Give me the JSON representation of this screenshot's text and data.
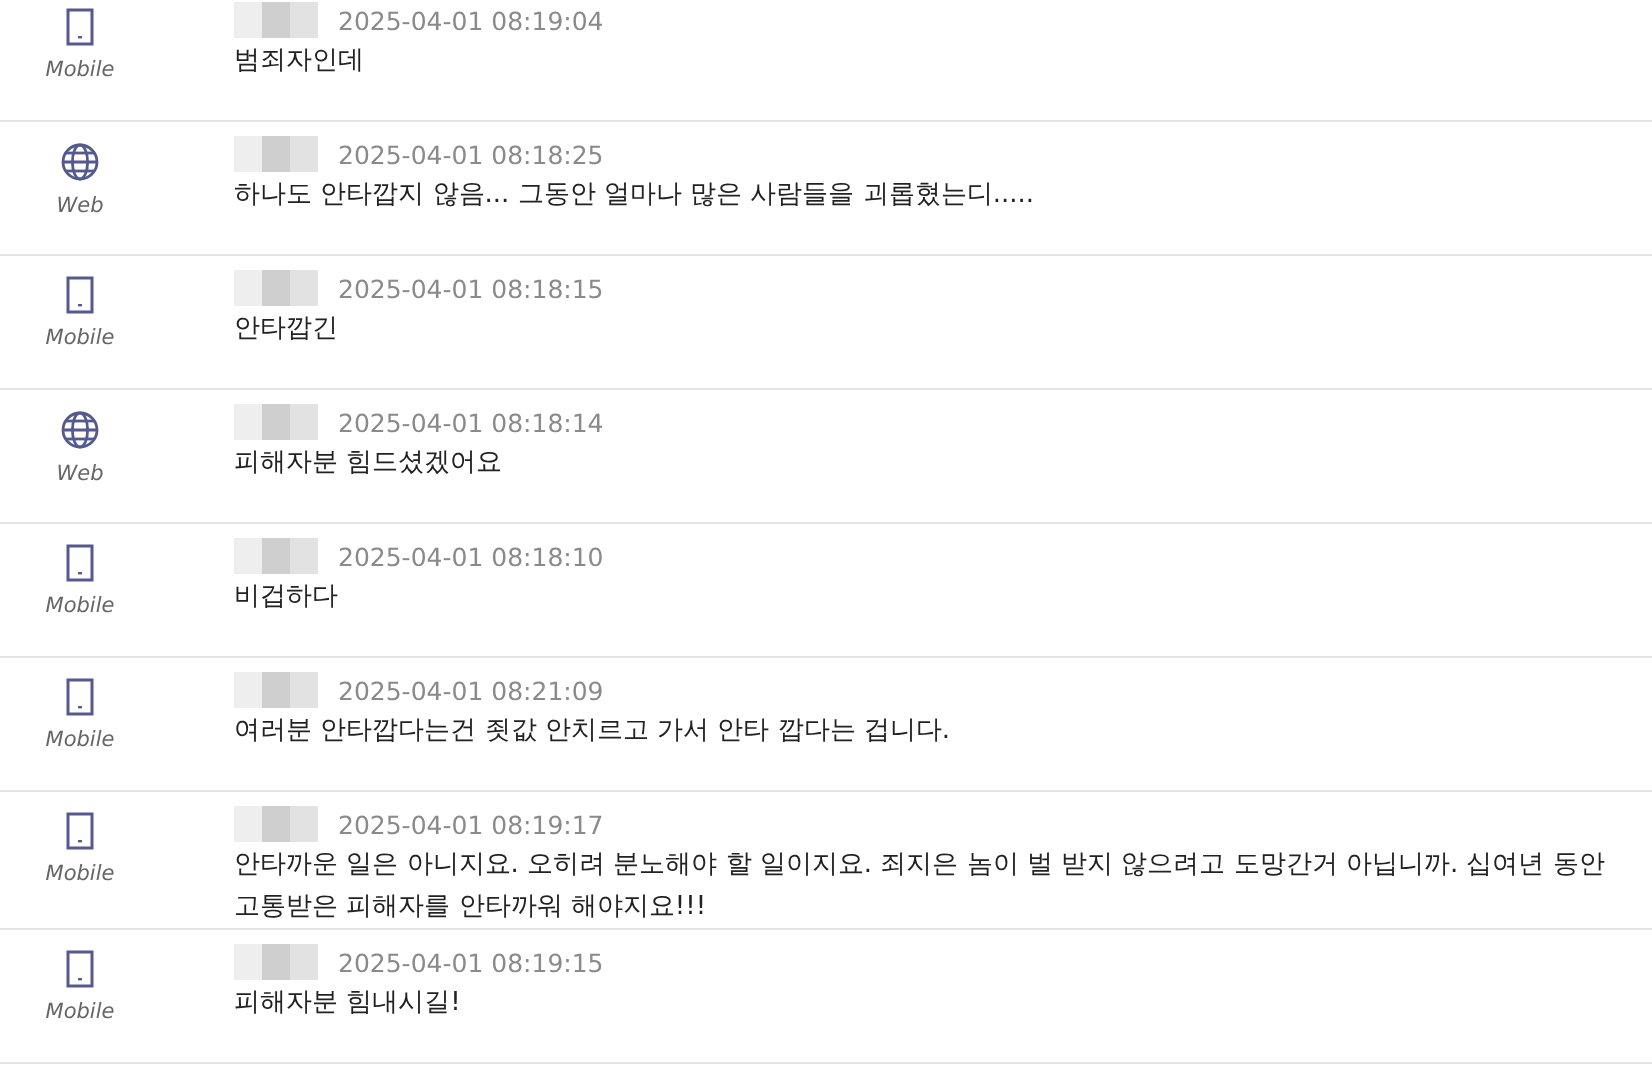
{
  "comments": [
    {
      "device": {
        "kind": "mobile",
        "label": "Mobile"
      },
      "time": "2025-04-01 08:19:04",
      "text": "범죄자인데"
    },
    {
      "device": {
        "kind": "web",
        "label": "Web"
      },
      "time": "2025-04-01 08:18:25",
      "text": "하나도 안타깝지 않음... 그동안 얼마나 많은 사람들을 괴롭혔는디....."
    },
    {
      "device": {
        "kind": "mobile",
        "label": "Mobile"
      },
      "time": "2025-04-01 08:18:15",
      "text": "안타깝긴"
    },
    {
      "device": {
        "kind": "web",
        "label": "Web"
      },
      "time": "2025-04-01 08:18:14",
      "text": "피해자분 힘드셨겠어요"
    },
    {
      "device": {
        "kind": "mobile",
        "label": "Mobile"
      },
      "time": "2025-04-01 08:18:10",
      "text": "비겁하다"
    },
    {
      "device": {
        "kind": "mobile",
        "label": "Mobile"
      },
      "time": "2025-04-01 08:21:09",
      "text": "여러분 안타깝다는건 죗값 안치르고 가서 안타 깝다는 겁니다."
    },
    {
      "device": {
        "kind": "mobile",
        "label": "Mobile"
      },
      "time": "2025-04-01 08:19:17",
      "text": "안타까운 일은 아니지요. 오히려 분노해야 할 일이지요. 죄지은 놈이 벌 받지 않으려고 도망간거 아닙니까. 십여년 동안 고통받은 피해자를 안타까워 해야지요!!!"
    },
    {
      "device": {
        "kind": "mobile",
        "label": "Mobile"
      },
      "time": "2025-04-01 08:19:15",
      "text": "피해자분 힘내시길!"
    }
  ]
}
